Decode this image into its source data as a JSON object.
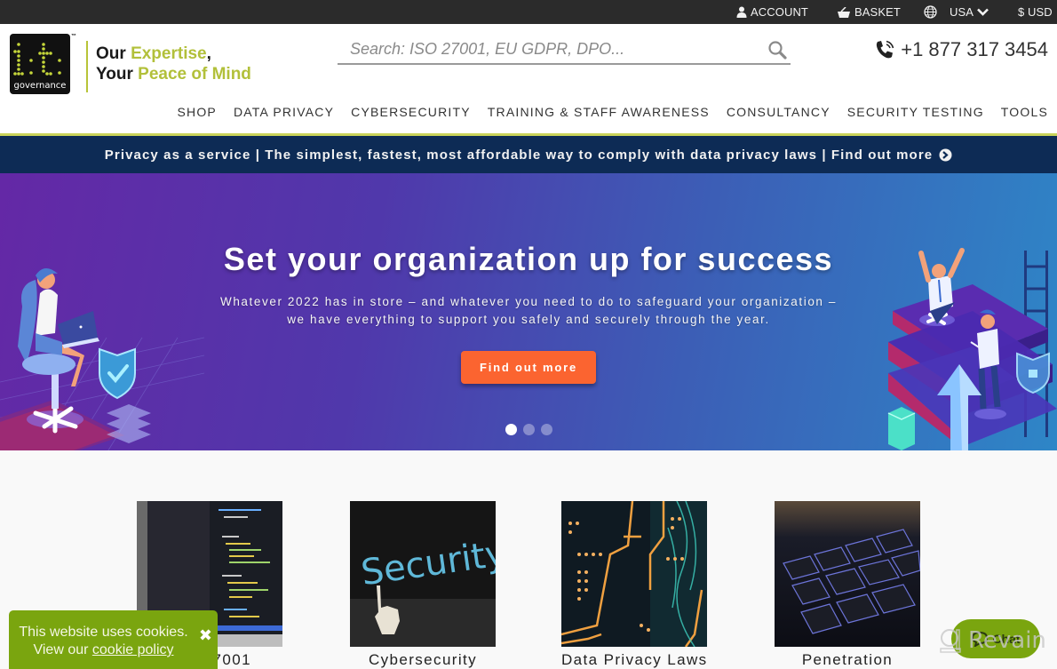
{
  "topbar": {
    "account_label": "ACCOUNT",
    "basket_label": "BASKET",
    "region_label": "USA",
    "currency_label": "$ USD"
  },
  "header": {
    "logo_text": "governance",
    "logo_tm": "™",
    "tagline_line1_a": "Our ",
    "tagline_line1_b": "Expertise",
    "tagline_line1_c": ",",
    "tagline_line2_a": "Your ",
    "tagline_line2_b": "Peace of Mind",
    "search_placeholder": "Search: ISO 27001, EU GDPR, DPO...",
    "search_value": "",
    "phone": "+1 877 317 3454",
    "brand_color": "#b2c03a"
  },
  "nav": {
    "items": [
      {
        "label": "SHOP"
      },
      {
        "label": "DATA PRIVACY"
      },
      {
        "label": "CYBERSECURITY"
      },
      {
        "label": "TRAINING & STAFF AWARENESS"
      },
      {
        "label": "CONSULTANCY"
      },
      {
        "label": "SECURITY TESTING"
      },
      {
        "label": "TOOLS"
      }
    ]
  },
  "promo": {
    "text": "Privacy as a service | The simplest, fastest, most affordable way to comply with data privacy laws | Find out more"
  },
  "hero": {
    "title": "Set your organization up for success",
    "subtitle_line1": "Whatever 2022 has in store – and whatever you need to do to safeguard your organization –",
    "subtitle_line2": "we have everything to support you safely and securely through the year.",
    "cta_label": "Find out more",
    "cta_color": "#fb6430",
    "slides_total": 3,
    "slide_active": 1
  },
  "cards": [
    {
      "label": "ISO 27001",
      "visible_label": "7001"
    },
    {
      "label": "Cybersecurity"
    },
    {
      "label": "Data Privacy Laws"
    },
    {
      "label": "Penetration"
    }
  ],
  "cookie": {
    "line1": "This website uses cookies.",
    "line2_prefix": "View our ",
    "link_label": "cookie policy",
    "close_icon": "✖"
  },
  "chat": {
    "label": "Chat"
  },
  "watermark": {
    "text": "Revain"
  }
}
